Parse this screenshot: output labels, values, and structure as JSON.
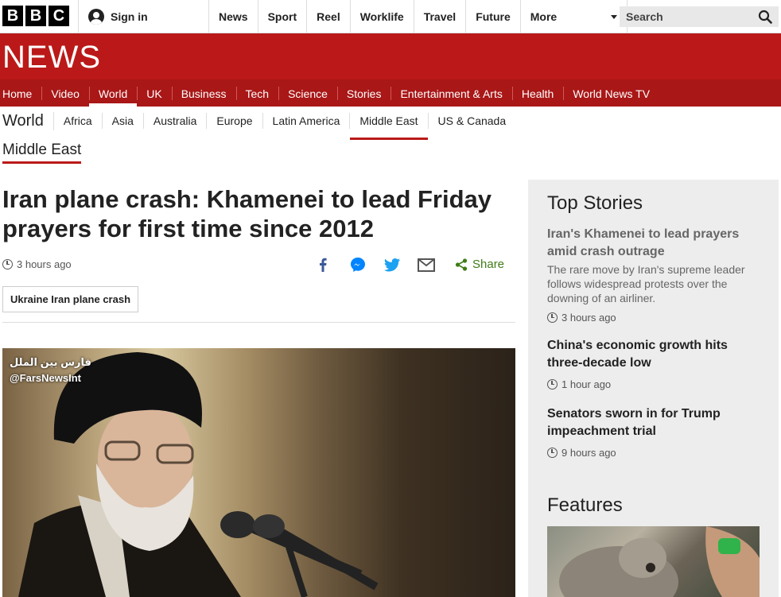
{
  "brand": {
    "logo": [
      "B",
      "B",
      "C"
    ]
  },
  "topbar": {
    "signin_label": "Sign in",
    "nav": [
      "News",
      "Sport",
      "Reel",
      "Worklife",
      "Travel",
      "Future"
    ],
    "more_label": "More",
    "search_placeholder": "Search"
  },
  "banner": {
    "title": "NEWS",
    "nav": [
      "Home",
      "Video",
      "World",
      "UK",
      "Business",
      "Tech",
      "Science",
      "Stories",
      "Entertainment & Arts",
      "Health",
      "World News TV"
    ],
    "active": "World"
  },
  "section": {
    "label": "World",
    "nav": [
      "Africa",
      "Asia",
      "Australia",
      "Europe",
      "Latin America",
      "Middle East",
      "US & Canada"
    ],
    "active": "Middle East",
    "subsection": "Middle East"
  },
  "article": {
    "headline": "Iran plane crash: Khamenei to lead Friday prayers for first time since 2012",
    "time": "3 hours ago",
    "share_label": "Share",
    "tag": "Ukraine Iran plane crash",
    "image_watermark_arabic": "فارس بين الملل",
    "image_watermark_handle": "@FarsNewsInt"
  },
  "sidebar": {
    "top_stories_heading": "Top Stories",
    "stories": [
      {
        "title": "Iran's Khamenei to lead prayers amid crash outrage",
        "summary": "The rare move by Iran's supreme leader follows widespread protests over the downing of an airliner.",
        "time": "3 hours ago"
      },
      {
        "title": "China's economic growth hits three-decade low",
        "summary": "",
        "time": "1 hour ago"
      },
      {
        "title": "Senators sworn in for Trump impeachment trial",
        "summary": "",
        "time": "9 hours ago"
      }
    ],
    "features_heading": "Features"
  },
  "colors": {
    "brand_red": "#bb1919",
    "share_green": "#407c17",
    "sidebar_bg": "#ededed"
  }
}
